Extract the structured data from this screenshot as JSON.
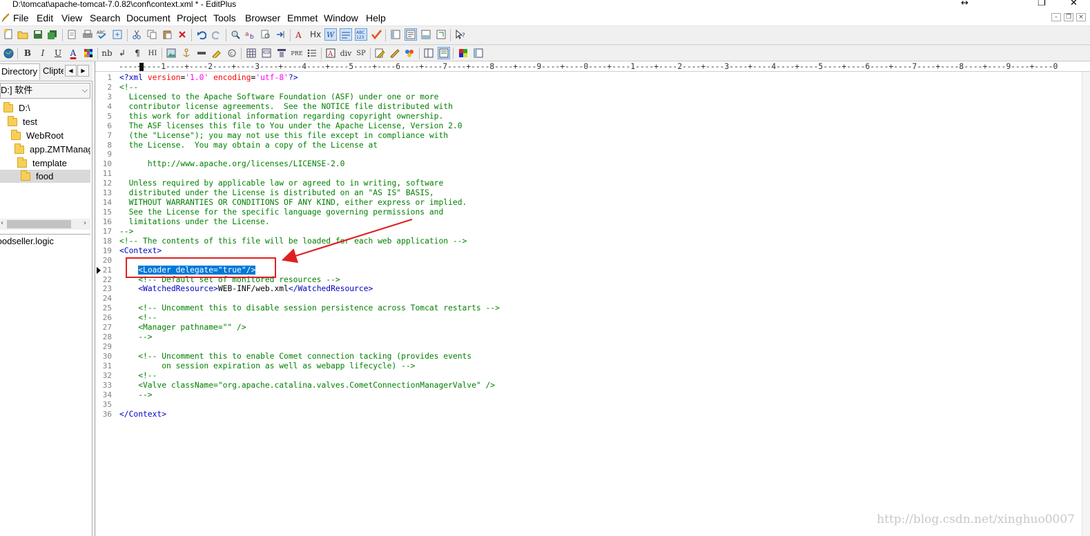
{
  "window": {
    "title": "D:\\tomcat\\apache-tomcat-7.0.82\\conf\\context.xml * - EditPlus",
    "controls": [
      "↔",
      "❐",
      "✕"
    ]
  },
  "menu": [
    "File",
    "Edit",
    "View",
    "Search",
    "Document",
    "Project",
    "Tools",
    "Browser",
    "Emmet",
    "Window",
    "Help"
  ],
  "toolbar_row2_text": {
    "bold": "B",
    "italic": "I",
    "underline": "U",
    "font_color": "A",
    "nbsp": "nb",
    "br": "↲",
    "para": "¶",
    "heading": "HI",
    "pre": "PRE",
    "div": "div",
    "sp": "SP",
    "hx": "Hx"
  },
  "sidebar": {
    "tabs": [
      "Directory",
      "Cliptext"
    ],
    "drive": "D:] 软件",
    "tree": [
      {
        "label": "D:\\",
        "indent": 0
      },
      {
        "label": "test",
        "indent": 1
      },
      {
        "label": "WebRoot",
        "indent": 2
      },
      {
        "label": "app.ZMTManag",
        "indent": 3
      },
      {
        "label": "template",
        "indent": 4
      },
      {
        "label": "food",
        "indent": 5,
        "selected": true
      }
    ],
    "files": [
      "foodseller.logic"
    ]
  },
  "editor": {
    "ruler": "----+----1----+----2----+----3----+----4----+----5----+----6----+----7----+----8----+----9----+----0----+----1----+----2----+----3----+----4----+----5----+----6----+----7----+----8----+----9----+----0",
    "current_line": 21,
    "selected_text": "<Loader delegate=\"true\"/>",
    "lines": [
      "<?xml version='1.0' encoding='utf-8'?>",
      "<!--",
      "  Licensed to the Apache Software Foundation (ASF) under one or more",
      "  contributor license agreements.  See the NOTICE file distributed with",
      "  this work for additional information regarding copyright ownership.",
      "  The ASF licenses this file to You under the Apache License, Version 2.0",
      "  (the \"License\"); you may not use this file except in compliance with",
      "  the License.  You may obtain a copy of the License at",
      "",
      "      http://www.apache.org/licenses/LICENSE-2.0",
      "",
      "  Unless required by applicable law or agreed to in writing, software",
      "  distributed under the License is distributed on an \"AS IS\" BASIS,",
      "  WITHOUT WARRANTIES OR CONDITIONS OF ANY KIND, either express or implied.",
      "  See the License for the specific language governing permissions and",
      "  limitations under the License.",
      "-->",
      "<!-- The contents of this file will be loaded for each web application -->",
      "<Context>",
      "",
      "    <Loader delegate=\"true\"/>",
      "    <!-- Default set of monitored resources -->",
      "    <WatchedResource>WEB-INF/web.xml</WatchedResource>",
      "",
      "    <!-- Uncomment this to disable session persistence across Tomcat restarts -->",
      "    <!--",
      "    <Manager pathname=\"\" />",
      "    -->",
      "",
      "    <!-- Uncomment this to enable Comet connection tacking (provides events",
      "         on session expiration as well as webapp lifecycle) -->",
      "    <!--",
      "    <Valve className=\"org.apache.catalina.valves.CometConnectionManagerValve\" />",
      "    -->",
      "",
      "</Context>"
    ]
  },
  "watermark": "http://blog.csdn.net/xinghuo0007",
  "colors": {
    "tag": "#0000c0",
    "attr": "#ff0000",
    "string": "#ff00ff",
    "comment": "#008000",
    "selection": "#0078d7",
    "annotation": "#e02020"
  }
}
